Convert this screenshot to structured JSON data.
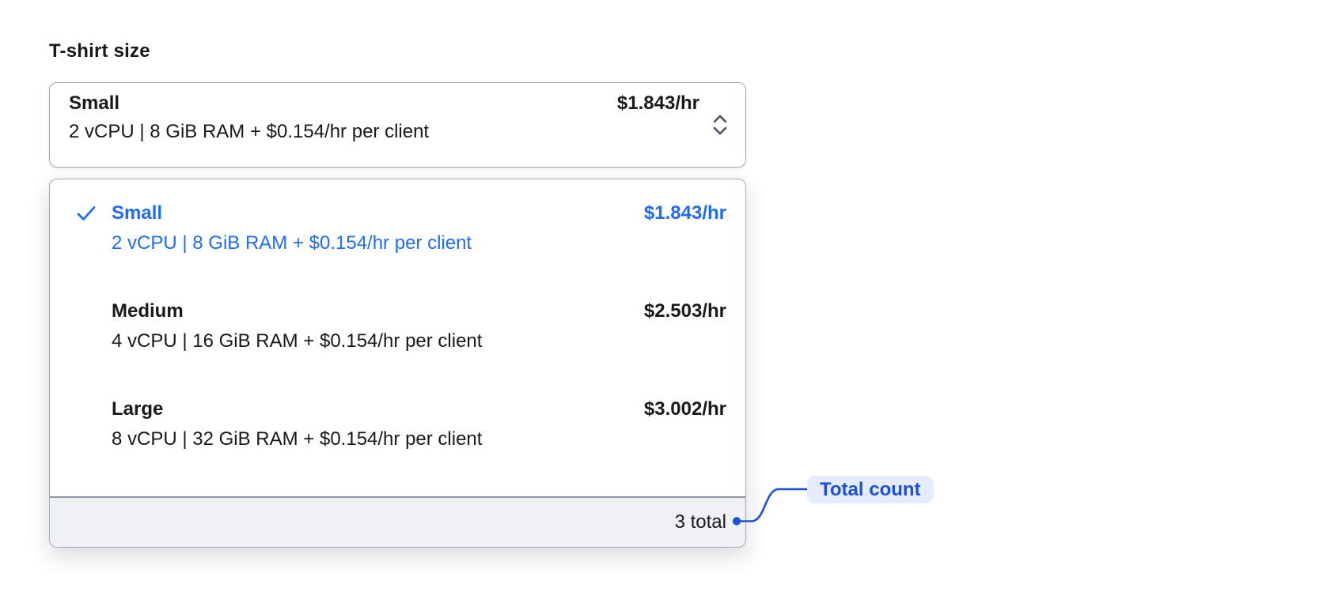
{
  "label": "T-shirt size",
  "trigger": {
    "selected_name": "Small",
    "selected_description": "2 vCPU | 8 GiB RAM + $0.154/hr per client",
    "selected_price": "$1.843/hr"
  },
  "dropdown": {
    "options": [
      {
        "name": "Small",
        "description": "2 vCPU | 8 GiB RAM + $0.154/hr per client",
        "price": "$1.843/hr",
        "selected": true
      },
      {
        "name": "Medium",
        "description": "4 vCPU | 16 GiB RAM + $0.154/hr per client",
        "price": "$2.503/hr",
        "selected": false
      },
      {
        "name": "Large",
        "description": "8 vCPU | 32 GiB RAM + $0.154/hr per client",
        "price": "$3.002/hr",
        "selected": false
      }
    ],
    "footer": {
      "total_label": "3 total"
    }
  },
  "annotation": {
    "label": "Total count"
  },
  "icons": {
    "check": "check-icon",
    "selector": "chevron-up-down-icon"
  },
  "colors": {
    "option_selected_blue": "#1f6bf2",
    "annotation_blue": "#1d50d9",
    "annotation_pill_bg": "#e4ecfd",
    "footer_bg": "#f0f1f4",
    "panel_border": "#a2a8b3",
    "footer_divider": "#8e95a1",
    "text": "#17191c",
    "chevron_gray": "#4a5160"
  }
}
